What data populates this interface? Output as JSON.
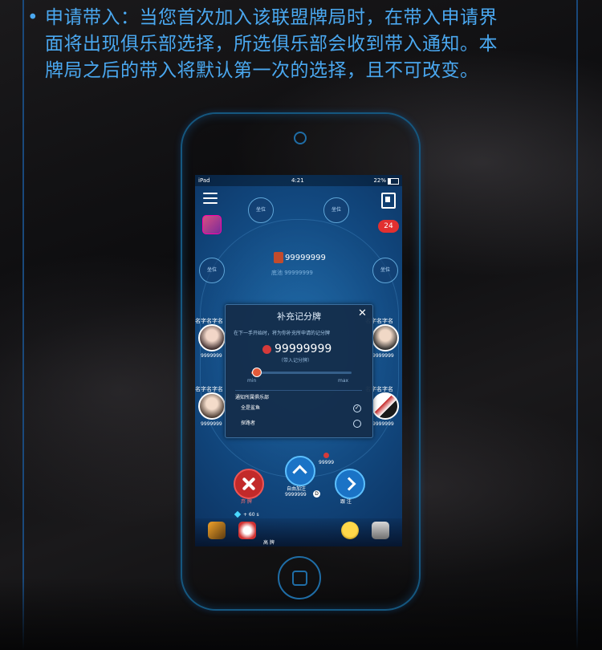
{
  "intro": {
    "bullet": "•",
    "line1": "申请带入：当您首次加入该联盟牌局时，在带入申请界",
    "line2": "面将出现俱乐部选择，所选俱乐部会收到带入通知。本",
    "line3": "牌局之后的带入将默认第一次的选择，且不可改变。"
  },
  "status": {
    "carrier": "iPad",
    "time": "4:21",
    "battery": "22%"
  },
  "badge": "24",
  "seats": {
    "label": "坐位"
  },
  "table": {
    "pot": "99999999",
    "pot_sub": "底池 99999999"
  },
  "players": {
    "name": "名字名字名字名字",
    "name_short": "名字名字名",
    "score": "9999999"
  },
  "dialog": {
    "title": "补充记分牌",
    "close": "✕",
    "description": "在下一手开始时，将为你补充所申请的记分牌",
    "amount": "99999999",
    "amount_sub": "（带入记分牌）",
    "slider_min": "min",
    "slider_max": "max",
    "slider_value": 0.05,
    "club_header": "通知所属俱乐部",
    "clubs": [
      {
        "name": "全是鲨鱼",
        "selected": true
      },
      {
        "name": "探路者",
        "selected": false
      }
    ]
  },
  "actions": {
    "fold": "弃 牌",
    "raise": "自由加注",
    "raise_amount": "9999999",
    "call": "跟 注",
    "chip_amount": "99999",
    "timer": "+ 60 s",
    "bottom_label": "高 牌"
  },
  "colors": {
    "accent": "#4aa8f0",
    "fold": "#c22a2a",
    "action": "#1a73c6",
    "badge": "#e23030"
  }
}
